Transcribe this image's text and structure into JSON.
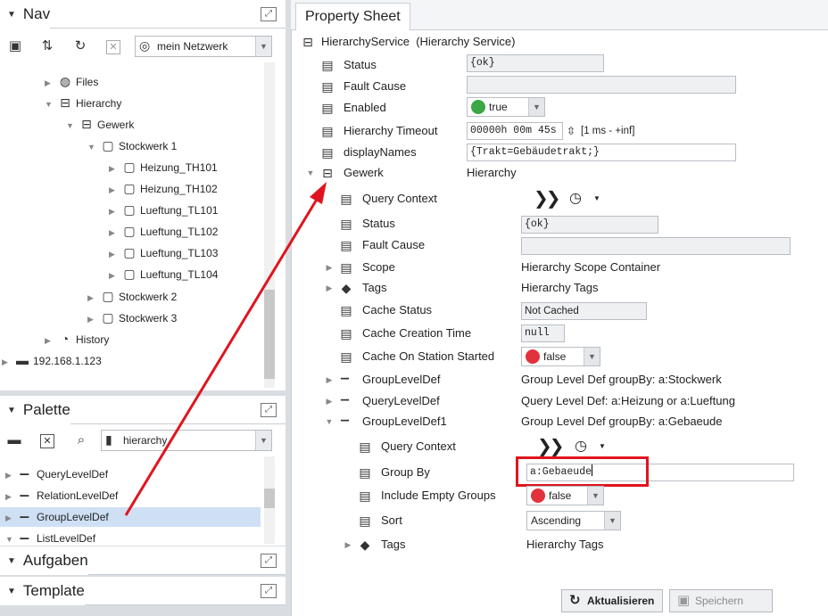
{
  "nav": {
    "title": "Nav",
    "network_select": "mein Netzwerk",
    "tree": [
      {
        "label": "Files",
        "icon": "globe-icon",
        "expander": "▶"
      },
      {
        "label": "Hierarchy",
        "icon": "hierarchy-icon",
        "expander": "▼"
      },
      {
        "label": "Gewerk",
        "icon": "hierarchy-icon",
        "expander": "▼"
      },
      {
        "label": "Stockwerk 1",
        "icon": "component-icon",
        "expander": "▼"
      },
      {
        "label": "Heizung_TH101",
        "icon": "component-icon",
        "expander": "▶"
      },
      {
        "label": "Heizung_TH102",
        "icon": "component-icon",
        "expander": "▶"
      },
      {
        "label": "Lueftung_TL101",
        "icon": "component-icon",
        "expander": "▶"
      },
      {
        "label": "Lueftung_TL102",
        "icon": "component-icon",
        "expander": "▶"
      },
      {
        "label": "Lueftung_TL103",
        "icon": "component-icon",
        "expander": "▶"
      },
      {
        "label": "Lueftung_TL104",
        "icon": "component-icon",
        "expander": "▶"
      },
      {
        "label": "Stockwerk 2",
        "icon": "component-icon",
        "expander": "▶"
      },
      {
        "label": "Stockwerk 3",
        "icon": "component-icon",
        "expander": "▶"
      },
      {
        "label": "History",
        "icon": "history-icon",
        "expander": "▶"
      },
      {
        "label": "192.168.1.123",
        "icon": "station-icon",
        "expander": "▶"
      }
    ]
  },
  "palette": {
    "title": "Palette",
    "module_select": "hierarchy",
    "items": [
      {
        "label": "QueryLevelDef"
      },
      {
        "label": "RelationLevelDef"
      },
      {
        "label": "GroupLevelDef"
      },
      {
        "label": "ListLevelDef"
      }
    ]
  },
  "aufgaben": {
    "title": "Aufgaben"
  },
  "template": {
    "title": "Template"
  },
  "property_sheet": {
    "tab": "Property Sheet",
    "root_name": "HierarchyService",
    "root_type": "(Hierarchy Service)",
    "rows": {
      "status": {
        "label": "Status",
        "value": "{ok}"
      },
      "fault_cause": {
        "label": "Fault Cause",
        "value": ""
      },
      "enabled": {
        "label": "Enabled",
        "value": "true"
      },
      "timeout": {
        "label": "Hierarchy Timeout",
        "value": "00000h 00m 45s",
        "range": "[1 ms - +inf]"
      },
      "display_names": {
        "label": "displayNames",
        "value": "{Trakt=Gebäudetrakt;}"
      },
      "gewerk": {
        "label": "Gewerk",
        "value": "Hierarchy"
      },
      "g_query_context": {
        "label": "Query Context"
      },
      "g_status": {
        "label": "Status",
        "value": "{ok}"
      },
      "g_fault_cause": {
        "label": "Fault Cause",
        "value": ""
      },
      "g_scope": {
        "label": "Scope",
        "value": "Hierarchy Scope Container"
      },
      "g_tags": {
        "label": "Tags",
        "value": "Hierarchy Tags"
      },
      "g_cache_status": {
        "label": "Cache Status",
        "value": "Not Cached"
      },
      "g_cache_time": {
        "label": "Cache Creation Time",
        "value": "null"
      },
      "g_cache_started": {
        "label": "Cache On Station Started",
        "value": "false"
      },
      "g_gld": {
        "label": "GroupLevelDef",
        "value": "Group Level Def groupBy:  a:Stockwerk"
      },
      "g_qld": {
        "label": "QueryLevelDef",
        "value": "Query Level Def: a:Heizung or a:Lueftung"
      },
      "g_gld1": {
        "label": "GroupLevelDef1",
        "value": "Group Level Def groupBy:  a:Gebaeude"
      },
      "l_query_context": {
        "label": "Query Context"
      },
      "l_group_by": {
        "label": "Group By",
        "value": "a:Gebaeude"
      },
      "l_include_empty": {
        "label": "Include Empty Groups",
        "value": "false"
      },
      "l_sort": {
        "label": "Sort",
        "value": "Ascending"
      },
      "l_tags": {
        "label": "Tags",
        "value": "Hierarchy Tags"
      }
    },
    "buttons": {
      "refresh": "Aktualisieren",
      "save": "Speichern"
    }
  },
  "colors": {
    "accent_red": "#e0141e",
    "true_green": "#3aa845",
    "false_red": "#e2323c",
    "selection": "#cfe0f5"
  }
}
